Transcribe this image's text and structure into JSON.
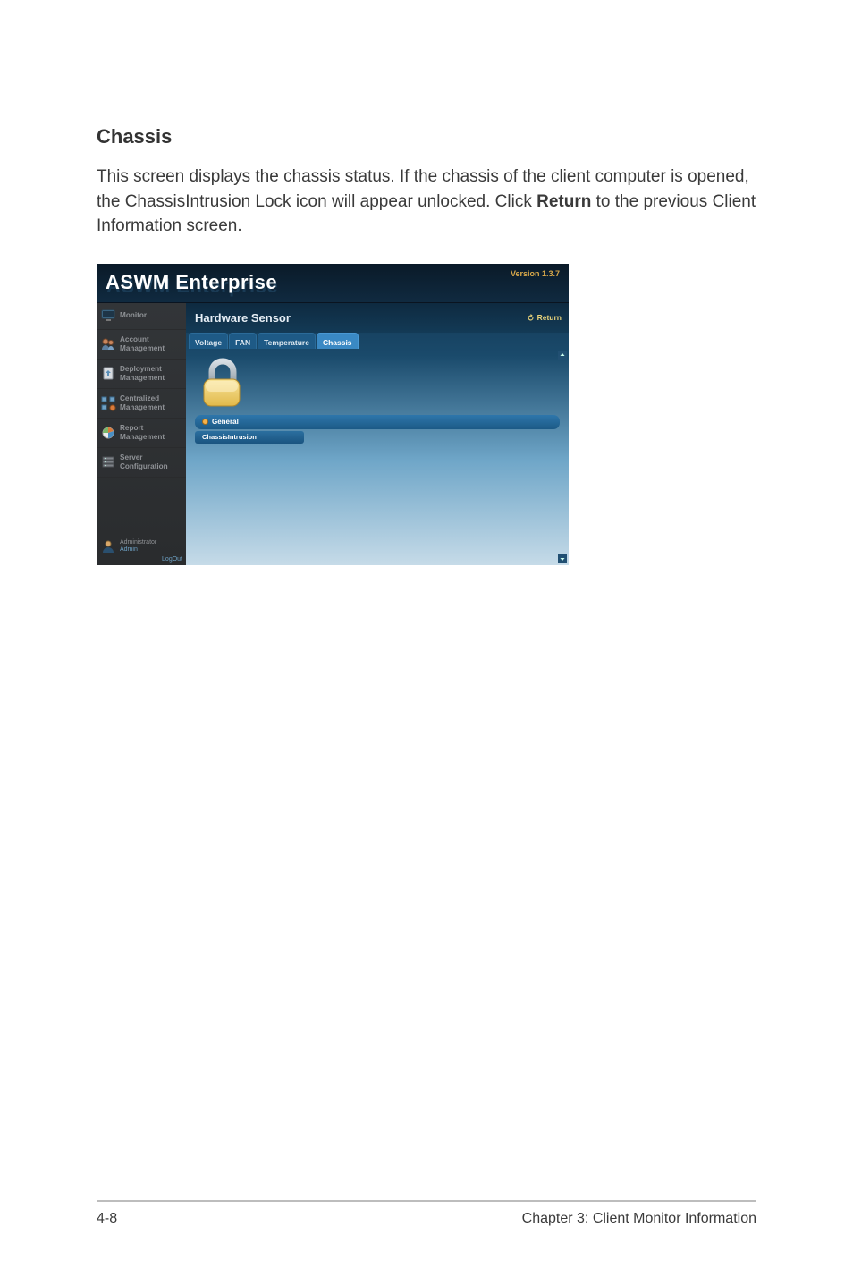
{
  "page": {
    "section_title": "Chassis",
    "body_text_pre": "This screen displays the chassis status. If the chassis of the client computer is opened, the ChassisIntrusion Lock icon will appear unlocked. Click ",
    "body_text_bold": "Return",
    "body_text_post": " to the previous Client Information screen.",
    "footer_left": "4-8",
    "footer_right": "Chapter 3: Client Monitor Information"
  },
  "app": {
    "logo": "ASWM Enterprise",
    "version": "Version 1.3.7",
    "main_title": "Hardware Sensor",
    "return_label": "Return",
    "tabs": {
      "voltage": "Voltage",
      "fan": "FAN",
      "temperature": "Temperature",
      "chassis": "Chassis"
    },
    "general_label": "General",
    "chassis_intrusion_label": "ChassisIntrusion",
    "sidebar": {
      "monitor": "Monitor",
      "account": "Account\nManagement",
      "deployment": "Deployment\nManagement",
      "centralized": "Centralized\nManagement",
      "report": "Report\nManagement",
      "server": "Server\nConfiguration"
    },
    "admin": {
      "role": "Administrator",
      "name": "Admin",
      "logout": "LogOut"
    }
  }
}
